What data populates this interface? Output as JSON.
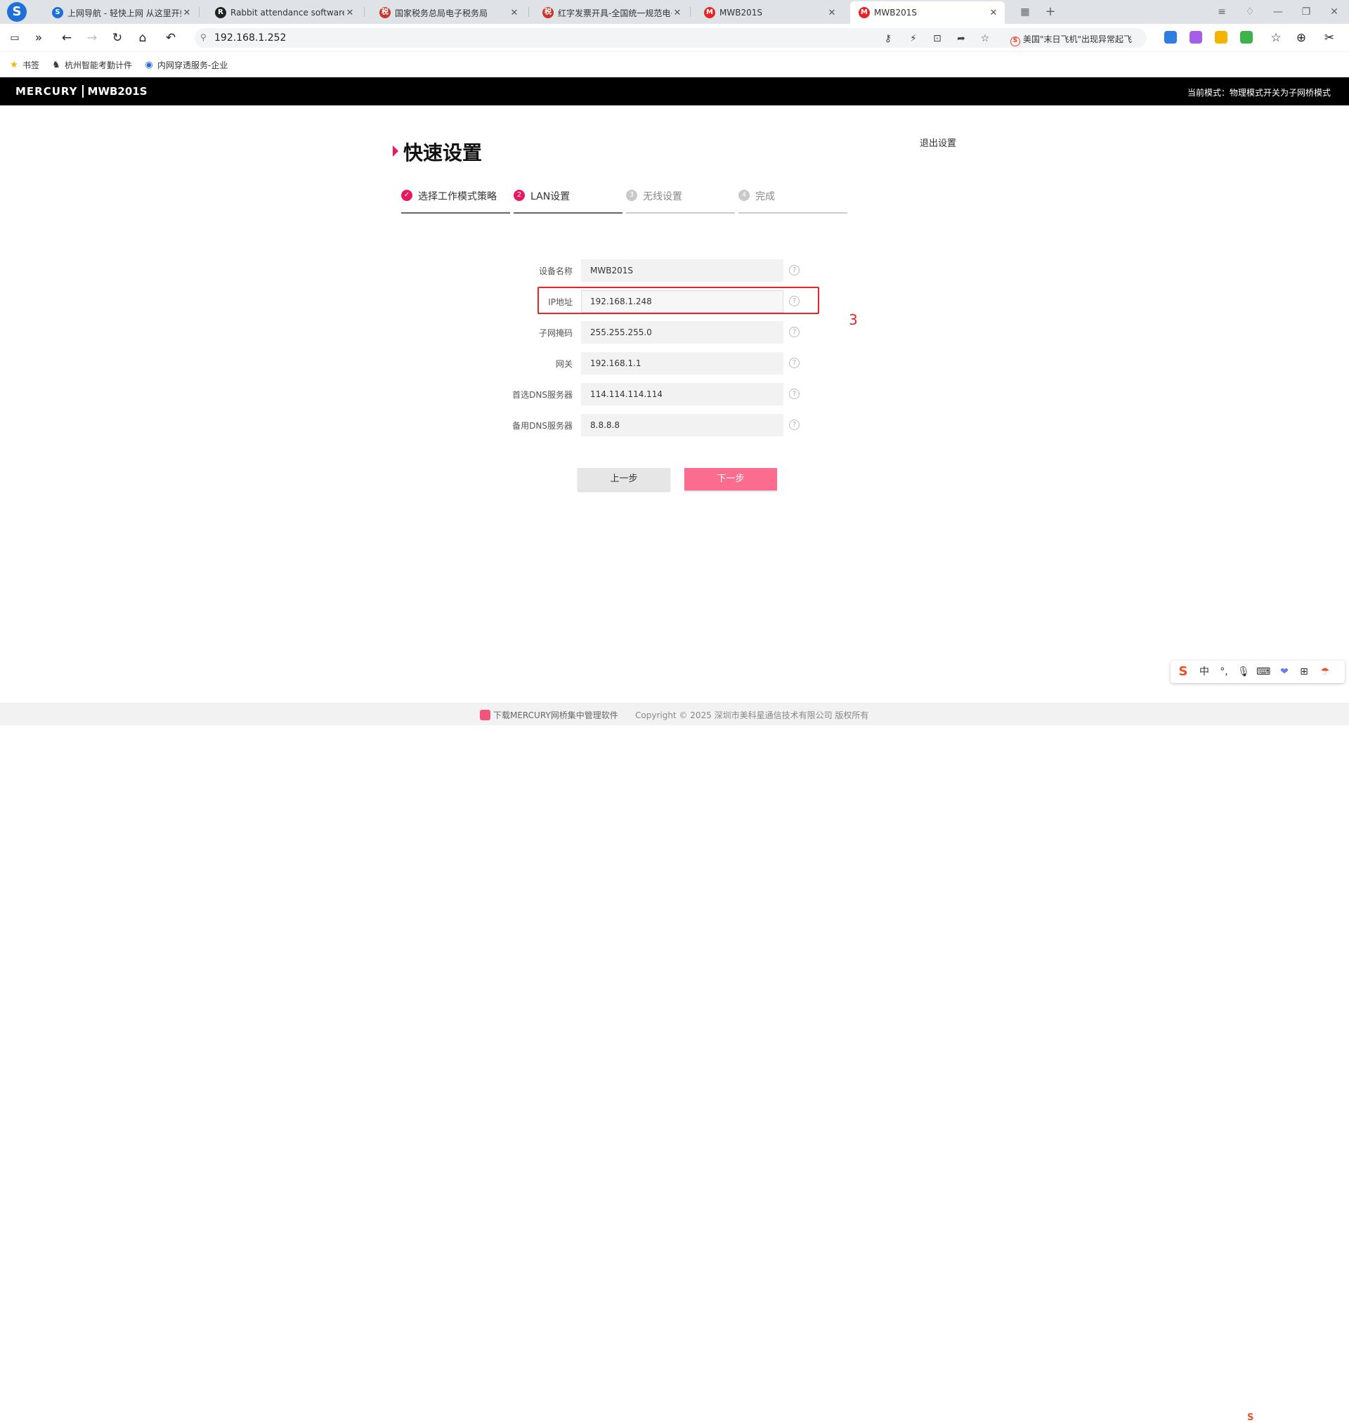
{
  "browser": {
    "tabs": [
      {
        "title": "上网导航 - 轻快上网 从这里开始",
        "fav_color": "#1e6fd9",
        "fav_glyph": "S"
      },
      {
        "title": "Rabbit attendance software",
        "fav_color": "#222222",
        "fav_glyph": "R"
      },
      {
        "title": "国家税务总局电子税务局",
        "fav_color": "#c9352b",
        "fav_glyph": "税"
      },
      {
        "title": "红字发票开具-全国统一规范电子",
        "fav_color": "#c9352b",
        "fav_glyph": "税"
      },
      {
        "title": "MWB201S",
        "fav_color": "#e8242a",
        "fav_glyph": "M"
      },
      {
        "title": "MWB201S",
        "fav_color": "#e8242a",
        "fav_glyph": "M"
      }
    ],
    "active_tab_index": 5,
    "url": "192.168.1.252",
    "news_ticker": "美国\"末日飞机\"出现异常起飞",
    "bookmarks": [
      {
        "label": "书签",
        "icon": "star-icon"
      },
      {
        "label": "杭州智能考勤计件",
        "icon": "rabbit-icon"
      },
      {
        "label": "内网穿透服务-企业",
        "icon": "globe-icon"
      }
    ]
  },
  "router": {
    "brand": "MERCURY",
    "model": "MWB201S",
    "mode_text": "当前模式：物理模式开关为子网桥模式"
  },
  "page": {
    "title": "快速设置",
    "exit_label": "退出设置",
    "steps": [
      {
        "num": "✓",
        "label": "选择工作模式策略",
        "state": "done"
      },
      {
        "num": "2",
        "label": "LAN设置",
        "state": "current"
      },
      {
        "num": "3",
        "label": "无线设置",
        "state": "pending"
      },
      {
        "num": "4",
        "label": "完成",
        "state": "pending"
      }
    ],
    "fields": [
      {
        "label": "设备名称",
        "value": "MWB201S"
      },
      {
        "label": "IP地址",
        "value": "192.168.1.248"
      },
      {
        "label": "子网掩码",
        "value": "255.255.255.0"
      },
      {
        "label": "网关",
        "value": "192.168.1.1"
      },
      {
        "label": "首选DNS服务器",
        "value": "114.114.114.114"
      },
      {
        "label": "备用DNS服务器",
        "value": "8.8.8.8"
      }
    ],
    "help_glyph": "?",
    "annotation": "3",
    "prev_label": "上一步",
    "next_label": "下一步"
  },
  "footer": {
    "download_link": "下载MERCURY网桥集中管理软件",
    "copyright": "Copyright © 2025 深圳市美科星通信技术有限公司 版权所有"
  },
  "ime": {
    "lang": "中",
    "items": [
      "S",
      "中",
      "°,",
      "mic",
      "keyboard",
      "skin",
      "grid",
      "tool"
    ]
  },
  "colors": {
    "accent_pink": "#e8195e",
    "button_pink": "#fc6c8e",
    "annotation_red": "#e8242a",
    "header_black": "#000000"
  }
}
